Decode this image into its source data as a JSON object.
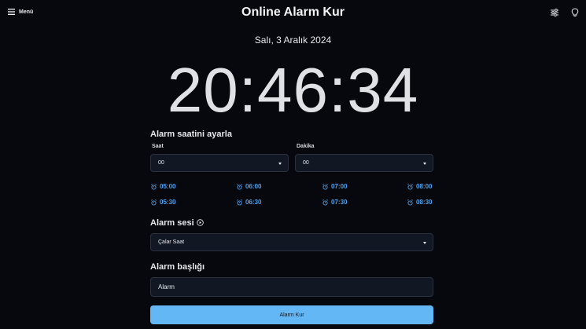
{
  "header": {
    "menu_label": "Menü",
    "title": "Online Alarm Kur"
  },
  "date_text": "Salı, 3 Aralık 2024",
  "clock_text": "20:46:34",
  "alarm_time": {
    "section_title": "Alarm saatini ayarla",
    "hour_label": "Saat",
    "hour_value": "00",
    "minute_label": "Dakika",
    "minute_value": "00",
    "presets": [
      "05:00",
      "06:00",
      "07:00",
      "08:00",
      "05:30",
      "06:30",
      "07:30",
      "08:30"
    ]
  },
  "alarm_sound": {
    "section_title": "Alarm sesi",
    "value": "Çalar Saat"
  },
  "alarm_title": {
    "section_title": "Alarm başlığı",
    "value": "Alarm"
  },
  "submit_label": "Alarm Kur",
  "colors": {
    "background": "#06080d",
    "accent": "#63b7f5",
    "preset_text": "#4aa3f0",
    "field_bg": "#111723"
  }
}
